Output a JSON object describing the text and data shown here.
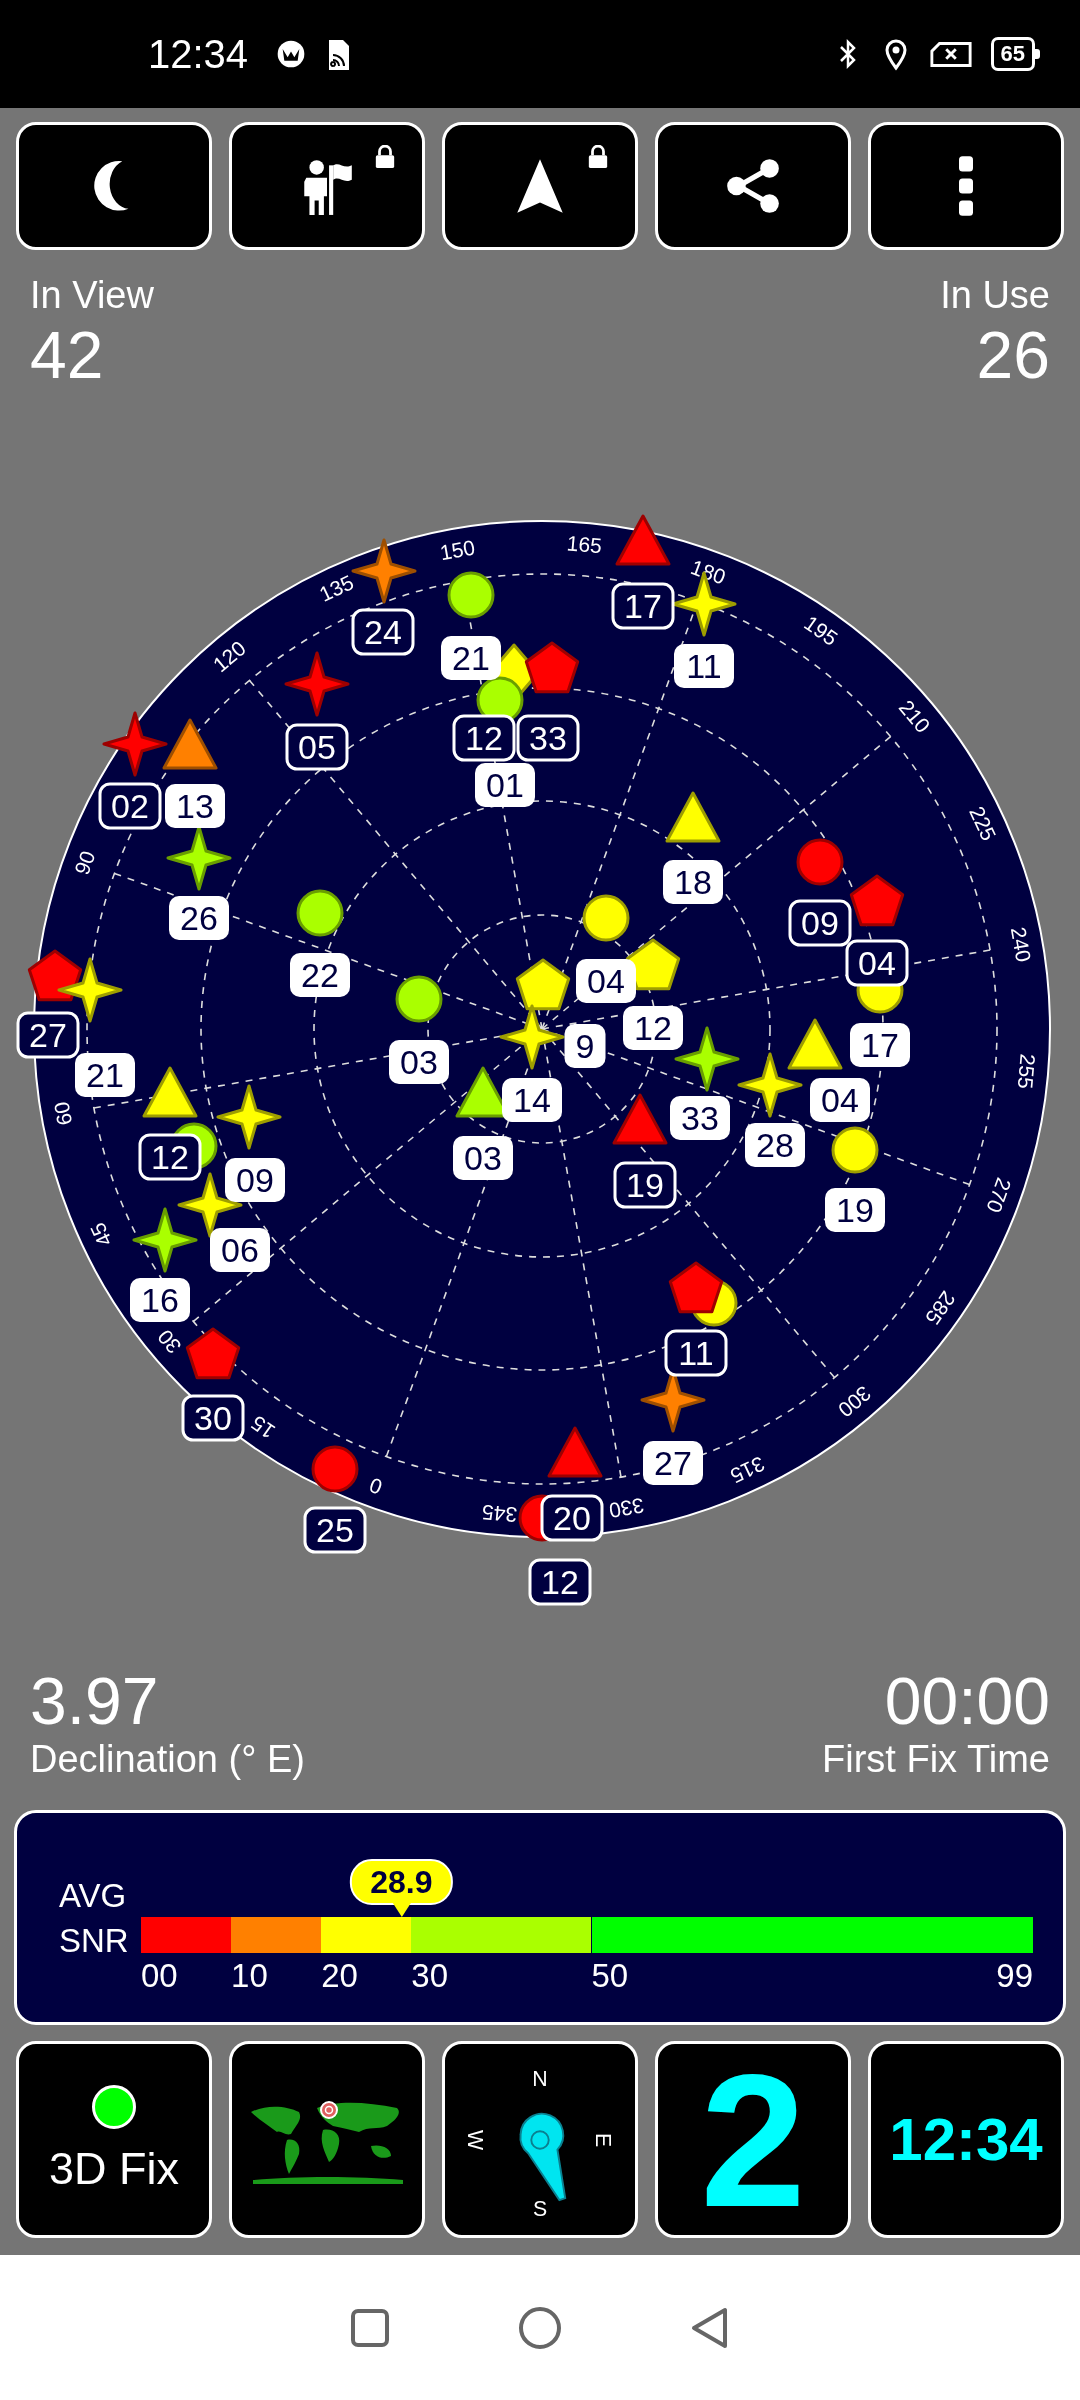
{
  "status_bar": {
    "time": "12:34",
    "battery": "65"
  },
  "toolbar": [
    {
      "kind": "night_mode",
      "locked": false
    },
    {
      "kind": "waypoint",
      "locked": true
    },
    {
      "kind": "navigate",
      "locked": true
    },
    {
      "kind": "share",
      "locked": false
    },
    {
      "kind": "menu",
      "locked": false
    }
  ],
  "in_view": {
    "label": "In View",
    "value": "42"
  },
  "in_use": {
    "label": "In Use",
    "value": "26"
  },
  "sky_plot": {
    "azimuth_labels": [
      "0",
      "15",
      "30",
      "45",
      "60",
      "90",
      "120",
      "135",
      "150",
      "165",
      "180",
      "195",
      "210",
      "225",
      "240",
      "255",
      "270",
      "285",
      "300",
      "315",
      "330",
      "345"
    ],
    "satellites": [
      {
        "label": "24",
        "kind": "star",
        "color": "#ff8000",
        "in_use": false
      },
      {
        "label": "21",
        "kind": "circle",
        "color": "#aaff00",
        "in_use": true
      },
      {
        "label": "17",
        "kind": "triangle",
        "color": "#ff0000",
        "in_use": false
      },
      {
        "label": "11",
        "kind": "star",
        "color": "#ffff00",
        "in_use": true
      },
      {
        "label": "05",
        "kind": "star",
        "color": "#ff0000",
        "in_use": false
      },
      {
        "label": "12",
        "kind": "diamond",
        "color": "#ffff00",
        "in_use": false
      },
      {
        "label": "33",
        "kind": "pentagon",
        "color": "#ff0000",
        "in_use": false
      },
      {
        "label": "01",
        "kind": "circle",
        "color": "#aaff00",
        "in_use": true
      },
      {
        "label": "02",
        "kind": "star",
        "color": "#ff0000",
        "in_use": false
      },
      {
        "label": "13",
        "kind": "triangle",
        "color": "#ff8000",
        "in_use": true
      },
      {
        "label": "26",
        "kind": "star",
        "color": "#aaff00",
        "in_use": true
      },
      {
        "label": "18",
        "kind": "triangle",
        "color": "#ffff00",
        "in_use": true
      },
      {
        "label": "09",
        "kind": "circle",
        "color": "#ff0000",
        "in_use": false
      },
      {
        "label": "04",
        "kind": "pentagon",
        "color": "#ff0000",
        "in_use": false
      },
      {
        "label": "17",
        "kind": "circle",
        "color": "#ffff00",
        "in_use": true
      },
      {
        "label": "22",
        "kind": "circle",
        "color": "#aaff00",
        "in_use": true
      },
      {
        "label": "04",
        "kind": "circle",
        "color": "#ffff00",
        "in_use": true
      },
      {
        "label": "12",
        "kind": "pentagon",
        "color": "#ffff00",
        "in_use": true
      },
      {
        "label": "27",
        "kind": "pentagon",
        "color": "#ff0000",
        "in_use": false
      },
      {
        "label": "21",
        "kind": "star",
        "color": "#ffff00",
        "in_use": true
      },
      {
        "label": "03",
        "kind": "circle",
        "color": "#aaff00",
        "in_use": true
      },
      {
        "label": "9",
        "kind": "pentagon",
        "color": "#ffff00",
        "in_use": true
      },
      {
        "label": "14",
        "kind": "star",
        "color": "#ffff00",
        "in_use": true
      },
      {
        "label": "03",
        "kind": "triangle",
        "color": "#aaff00",
        "in_use": true
      },
      {
        "label": "33",
        "kind": "star",
        "color": "#aaff00",
        "in_use": true
      },
      {
        "label": "19",
        "kind": "triangle",
        "color": "#ff0000",
        "in_use": false
      },
      {
        "label": "04",
        "kind": "triangle",
        "color": "#ffff00",
        "in_use": true
      },
      {
        "label": "28",
        "kind": "star",
        "color": "#ffff00",
        "in_use": true
      },
      {
        "label": "19",
        "kind": "circle",
        "color": "#ffff00",
        "in_use": true
      },
      {
        "label": "12",
        "kind": "triangle",
        "color": "#ffff00",
        "in_use": false
      },
      {
        "kind": "circle",
        "color": "#aaff00"
      },
      {
        "label": "09",
        "kind": "star",
        "color": "#ffff00",
        "in_use": true
      },
      {
        "label": "06",
        "kind": "star",
        "color": "#ffff00",
        "in_use": true
      },
      {
        "label": "16",
        "kind": "star",
        "color": "#aaff00",
        "in_use": true
      },
      {
        "label": "30",
        "kind": "pentagon",
        "color": "#ff0000",
        "in_use": false
      },
      {
        "label": "25",
        "kind": "circle",
        "color": "#ff0000",
        "in_use": false
      },
      {
        "kind": "circle",
        "color": "#ffff00"
      },
      {
        "label": "11",
        "kind": "pentagon",
        "color": "#ff0000",
        "in_use": false
      },
      {
        "label": "27",
        "kind": "star",
        "color": "#ff8000",
        "in_use": true
      },
      {
        "label": "20",
        "kind": "triangle",
        "color": "#ff0000",
        "in_use": false
      },
      {
        "label": "12",
        "kind": "circle",
        "color": "#ff0000",
        "in_use": false
      }
    ]
  },
  "declination": {
    "value": "3.97",
    "label": "Declination (° E)"
  },
  "first_fix": {
    "value": "00:00",
    "label": "First Fix Time"
  },
  "snr": {
    "labels": [
      "AVG",
      "SNR"
    ],
    "value": "28.9",
    "ticks": [
      "00",
      "10",
      "20",
      "30",
      "50",
      "99"
    ],
    "bands": [
      {
        "color": "#ff0000"
      },
      {
        "color": "#ff8000"
      },
      {
        "color": "#ffff00"
      },
      {
        "color": "#aaff00"
      },
      {
        "color": "#00ff00"
      }
    ]
  },
  "tiles": [
    {
      "kind": "fix",
      "label": "3D Fix",
      "color": "#00ff00"
    },
    {
      "kind": "map"
    },
    {
      "kind": "compass",
      "directions": [
        "N",
        "E",
        "S",
        "W"
      ]
    },
    {
      "kind": "number",
      "value": "2"
    },
    {
      "kind": "clock",
      "value": "12:34"
    }
  ]
}
